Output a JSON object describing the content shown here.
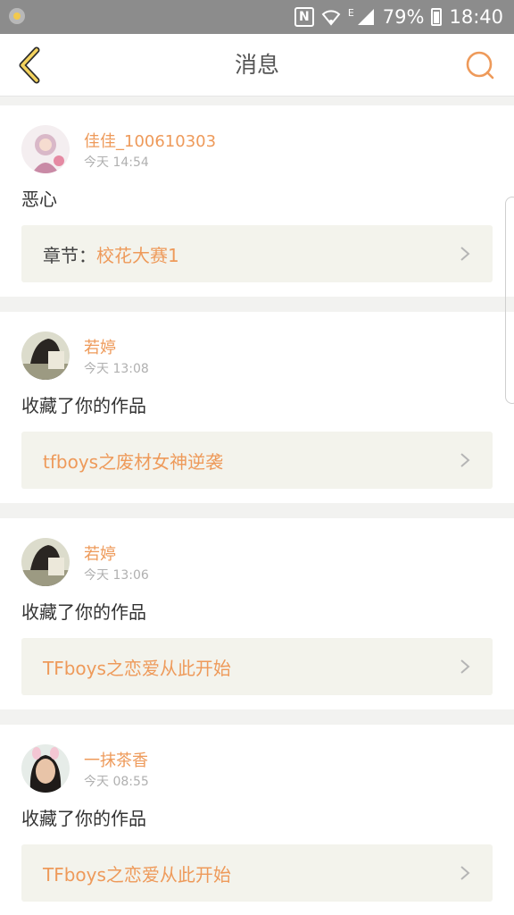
{
  "status_bar": {
    "battery_percent": "79%",
    "time": "18:40",
    "network_type": "E",
    "icons": [
      "notification-icon",
      "nfc-icon",
      "wifi-icon",
      "signal-icon",
      "battery-icon"
    ]
  },
  "header": {
    "title": "消息",
    "back_icon": "chevron-left-icon",
    "search_icon": "search-icon",
    "accent_color": "#ee9a5a"
  },
  "messages": [
    {
      "username": "佳佳_100610303",
      "time": "今天 14:54",
      "text": "恶心",
      "ref_prefix": "章节：",
      "ref_title": "校花大赛1"
    },
    {
      "username": "若婷",
      "time": "今天 13:08",
      "text": "收藏了你的作品",
      "ref_prefix": "",
      "ref_title": "tfboys之废材女神逆袭"
    },
    {
      "username": "若婷",
      "time": "今天 13:06",
      "text": "收藏了你的作品",
      "ref_prefix": "",
      "ref_title": "TFboys之恋爱从此开始"
    },
    {
      "username": "一抹茶香",
      "time": "今天 08:55",
      "text": "收藏了你的作品",
      "ref_prefix": "",
      "ref_title": "TFboys之恋爱从此开始"
    }
  ]
}
